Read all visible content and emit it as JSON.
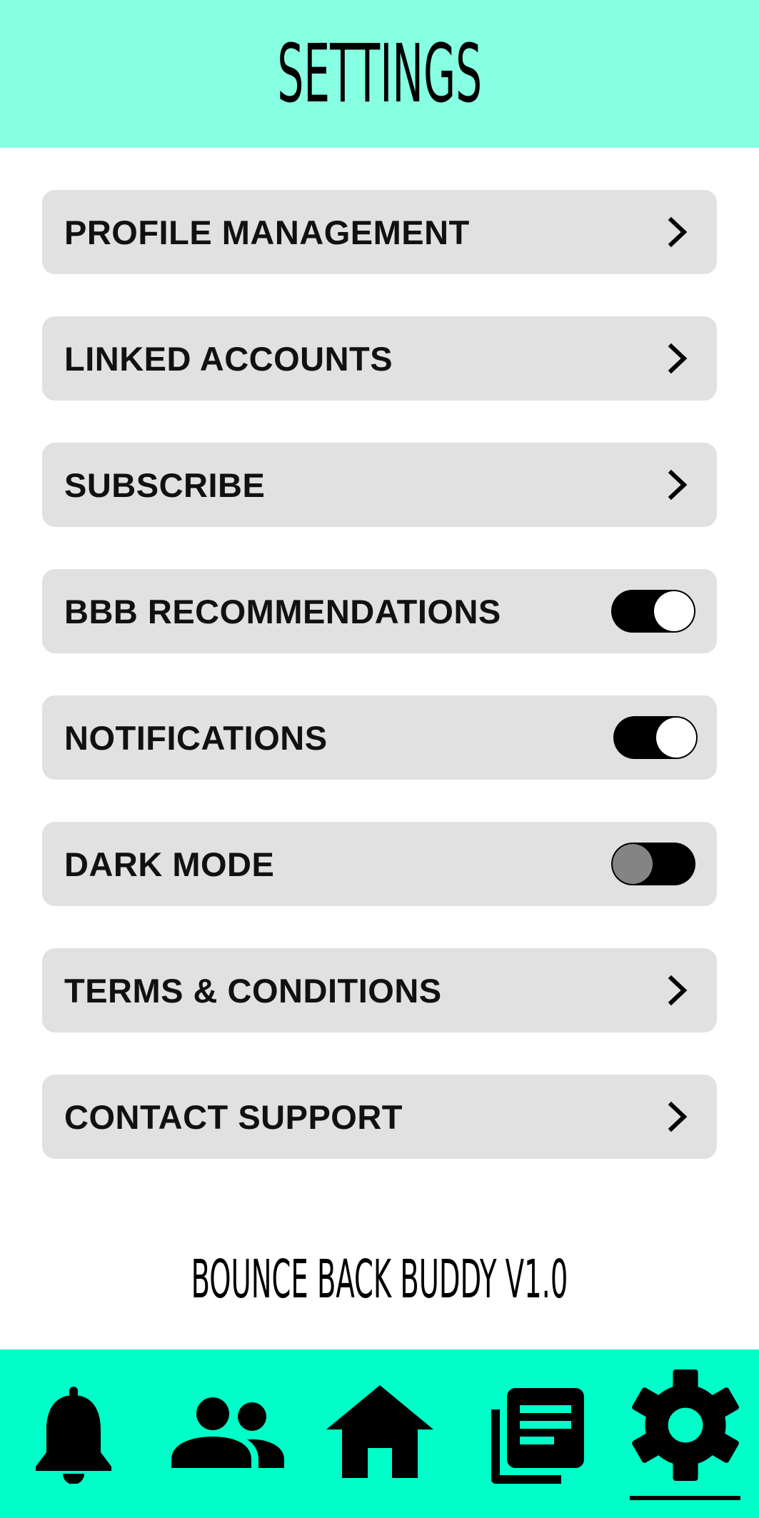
{
  "header": {
    "title": "SETTINGS"
  },
  "settings": [
    {
      "label": "PROFILE MANAGEMENT",
      "control": "chevron"
    },
    {
      "label": "LINKED ACCOUNTS",
      "control": "chevron"
    },
    {
      "label": "SUBSCRIBE",
      "control": "chevron"
    },
    {
      "label": "BBB RECOMMENDATIONS",
      "control": "toggle",
      "state": "on"
    },
    {
      "label": "NOTIFICATIONS",
      "control": "toggle",
      "state": "on"
    },
    {
      "label": "DARK MODE",
      "control": "toggle",
      "state": "off"
    },
    {
      "label": "TERMS & CONDITIONS",
      "control": "chevron"
    },
    {
      "label": "CONTACT SUPPORT",
      "control": "chevron"
    }
  ],
  "footer": {
    "version": "BOUNCE BACK BUDDY V1.0"
  },
  "bottom_nav": {
    "items": [
      {
        "icon": "bell-icon",
        "name": "notifications"
      },
      {
        "icon": "people-icon",
        "name": "community"
      },
      {
        "icon": "home-icon",
        "name": "home"
      },
      {
        "icon": "articles-icon",
        "name": "articles"
      },
      {
        "icon": "gear-icon",
        "name": "settings",
        "active": true
      }
    ]
  },
  "colors": {
    "header_bg": "#86ffe2",
    "nav_bg": "#00ffc8",
    "row_bg": "#e1e1e1",
    "toggle_track": "#000000",
    "toggle_knob_on": "#ffffff",
    "toggle_knob_off": "#848484"
  }
}
